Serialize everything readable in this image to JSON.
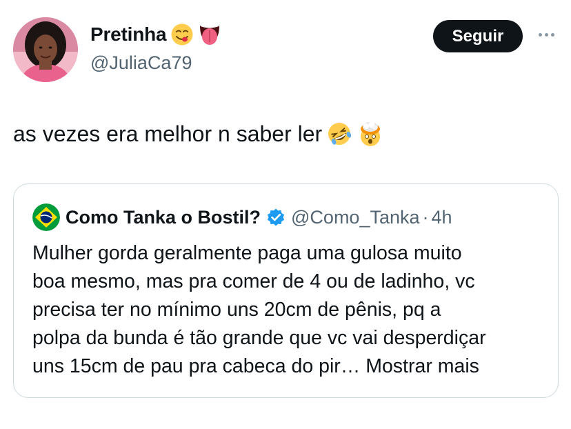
{
  "author": {
    "display_name": "Pretinha",
    "handle": "@JuliaCa79",
    "name_emojis": [
      "yum-emoji",
      "tongue-emoji"
    ]
  },
  "actions": {
    "follow_label": "Seguir",
    "more_icon": "more-dots-icon"
  },
  "tweet": {
    "text": "as vezes era melhor n saber ler",
    "emojis": [
      "rofl-emoji",
      "exploding-head-emoji"
    ]
  },
  "quote": {
    "display_name": "Como Tanka o Bostil?",
    "handle": "@Como_Tanka",
    "separator": "·",
    "time": "4h",
    "lines": [
      "Mulher gorda geralmente paga uma gulosa muito",
      "boa mesmo, mas pra comer de 4 ou de ladinho, vc",
      "precisa ter no mínimo uns 20cm de pênis, pq a",
      "polpa da bunda é tão grande que vc vai desperdiçar",
      "uns 15cm de pau pra cabeca do pir…"
    ],
    "show_more": "Mostrar mais"
  },
  "colors": {
    "text": "#0f1419",
    "secondary": "#536471",
    "border": "#cfd9de",
    "verified": "#1d9bf0",
    "button_bg": "#0f1419"
  }
}
